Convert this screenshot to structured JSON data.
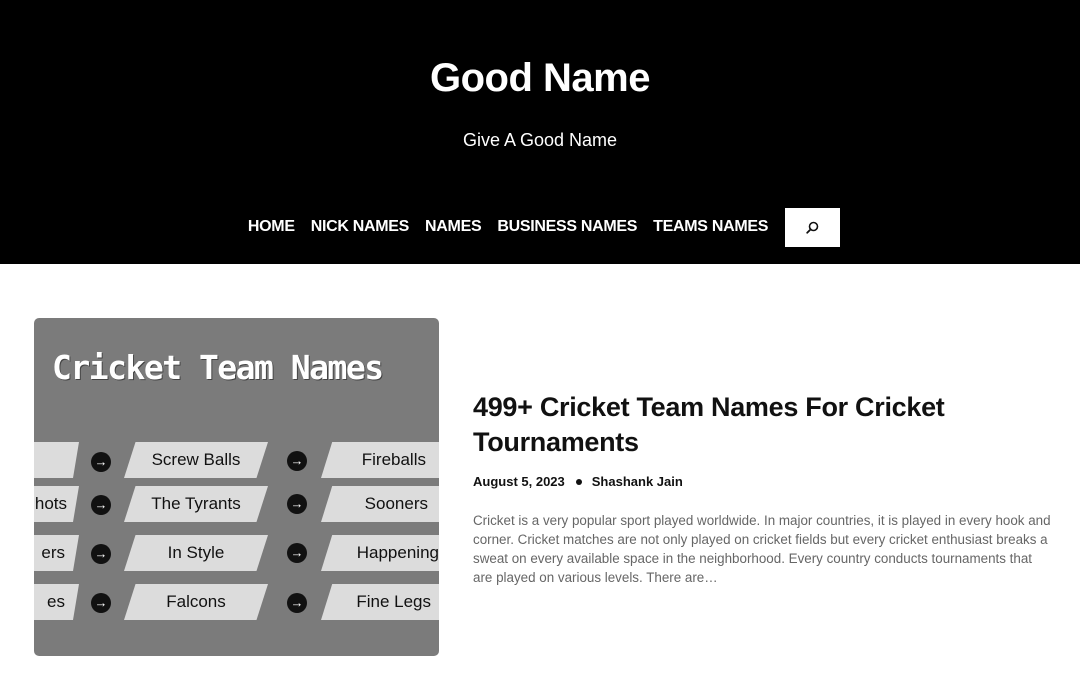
{
  "site": {
    "title": "Good Name",
    "tagline": "Give A Good Name"
  },
  "nav": {
    "items": [
      {
        "label": "HOME"
      },
      {
        "label": "NICK NAMES"
      },
      {
        "label": "NAMES"
      },
      {
        "label": "BUSINESS NAMES"
      },
      {
        "label": "TEAMS NAMES"
      }
    ],
    "search_icon": "search-icon"
  },
  "post": {
    "thumbnail": {
      "title": "Cricket Team Names",
      "col1": [
        "",
        "hots",
        "ers",
        "es"
      ],
      "col2": [
        "Screw Balls",
        "The Tyrants",
        "In Style",
        "Falcons"
      ],
      "col3": [
        "Fireballs",
        "Sooners",
        "Happening",
        "Fine Legs"
      ]
    },
    "title": "499+ Cricket Team Names For Cricket Tournaments",
    "date": "August 5, 2023",
    "author": "Shashank Jain",
    "excerpt": "Cricket is a very popular sport played worldwide. In major countries, it is played in every hook and corner. Cricket matches are not only played on cricket fields but every cricket enthusiast breaks a sweat on every available space in the neighborhood. Every country conducts tournaments that are played on various levels. There are…"
  }
}
